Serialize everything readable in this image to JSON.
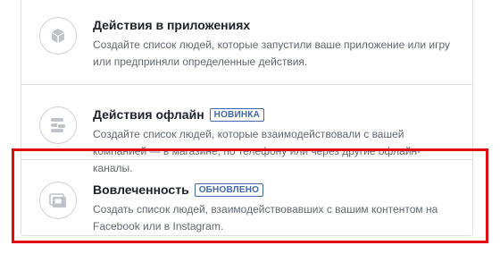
{
  "options": [
    {
      "title": "Действия в приложениях",
      "badge": "",
      "description": "Создайте список людей, которые запустили ваше приложение или игру или предприняли определенные действия.",
      "icon": "cube-icon"
    },
    {
      "title": "Действия офлайн",
      "badge": "НОВИНКА",
      "description": "Создайте список людей, которые взаимодействовали с вашей компанией — в магазине, по телефону или через другие офлайн-каналы.",
      "icon": "stack-icon"
    },
    {
      "title": "Вовлеченность",
      "badge": "ОБНОВЛЕНО",
      "description": "Создать список людей, взаимодействовавших с вашим контентом на Facebook или в Instagram.",
      "icon": "cards-icon"
    }
  ],
  "colors": {
    "badge": "#4267b2",
    "highlight": "#e10b0b",
    "icon": "#bec3c9"
  }
}
